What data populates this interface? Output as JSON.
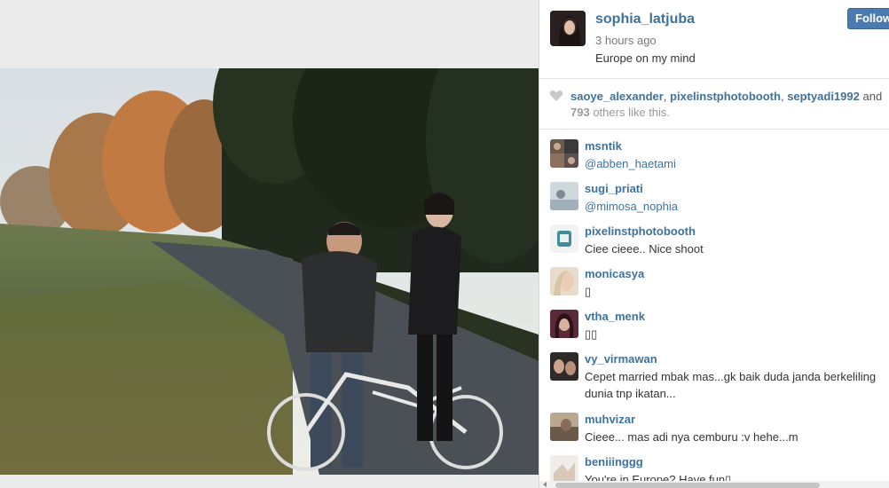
{
  "post": {
    "username": "sophia_latjuba",
    "time": "3 hours ago",
    "caption": "Europe on my mind",
    "follow_label": "Follow"
  },
  "likes": {
    "user1": "saoye_alexander",
    "user2": "pixelinstphotobooth",
    "user3": "septyadi1992",
    "and": "and",
    "count": "793",
    "others_text": "others like this."
  },
  "comments": [
    {
      "user": "msntik",
      "text": "@abben_haetami"
    },
    {
      "user": "sugi_priati",
      "text": "@mimosa_nophia"
    },
    {
      "user": "pixelinstphotobooth",
      "text": "Ciee cieee.. Nice shoot"
    },
    {
      "user": "monicasya",
      "text": "▯"
    },
    {
      "user": "vtha_menk",
      "text": "▯▯"
    },
    {
      "user": "vy_virmawan",
      "text": "Cepet married mbak mas...gk baik duda janda berkeliling dunia tnp ikatan..."
    },
    {
      "user": "muhvizar",
      "text": "Cieee... mas adi nya cemburu :v hehe...m"
    },
    {
      "user": "beniiinggg",
      "text": "You're in Europe? Have fun▯"
    }
  ],
  "icons": {
    "heart": "heart-icon",
    "scroll_left": "scroll-left-arrow-icon"
  },
  "colors": {
    "link": "#3f729b",
    "follow_button": "#4a7ab0"
  }
}
